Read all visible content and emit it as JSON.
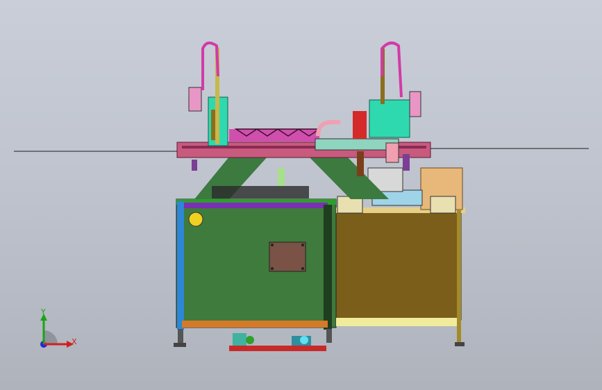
{
  "viewport": {
    "background_top": "#c9ced8",
    "background_bottom": "#aeb3bc"
  },
  "triad": {
    "x_label": "X",
    "y_label": "Y",
    "x_color": "#d21e1e",
    "y_color": "#1aa31a",
    "z_color": "#1e2ad2"
  },
  "model": {
    "frame_left_color": "#3f7b3c",
    "frame_right_color": "#7a5e1a",
    "gantry_beam_color": "#c85a7d",
    "head_color": "#2ed9b0",
    "accent_magenta": "#d33aa6"
  }
}
